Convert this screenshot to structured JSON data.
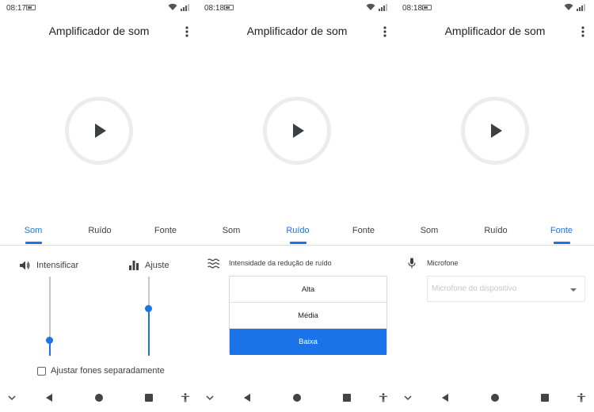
{
  "screens": [
    {
      "status": {
        "time": "08:17"
      },
      "title": "Amplificador de som",
      "tabs": [
        "Som",
        "Ruído",
        "Fonte"
      ],
      "active_tab": "Som",
      "som": {
        "boost_label": "Intensificar",
        "tune_label": "Ajuste",
        "boost_level": 0.2,
        "tune_level": 0.6,
        "checkbox_label": "Ajustar fones separadamente",
        "checkbox_checked": false
      }
    },
    {
      "status": {
        "time": "08:18"
      },
      "title": "Amplificador de som",
      "tabs": [
        "Som",
        "Ruído",
        "Fonte"
      ],
      "active_tab": "Ruído",
      "ruido": {
        "label": "Intensidade da redução de ruído",
        "options": [
          "Alta",
          "Média",
          "Baixa"
        ],
        "selected": "Baixa"
      }
    },
    {
      "status": {
        "time": "08:18"
      },
      "title": "Amplificador de som",
      "tabs": [
        "Som",
        "Ruído",
        "Fonte"
      ],
      "active_tab": "Fonte",
      "fonte": {
        "label": "Microfone",
        "placeholder": "Microfone do dispositivo"
      }
    }
  ],
  "colors": {
    "accent": "#1a73e8",
    "ring": "#ececec",
    "text": "#202124"
  },
  "icons": [
    "wifi-icon",
    "signal-icon",
    "battery-icon",
    "more-vert-icon",
    "play-icon",
    "volume-icon",
    "bar-chart-icon",
    "waves-icon",
    "mic-icon",
    "nav-down-icon",
    "nav-back-icon",
    "nav-home-icon",
    "nav-recents-icon",
    "accessibility-icon"
  ]
}
